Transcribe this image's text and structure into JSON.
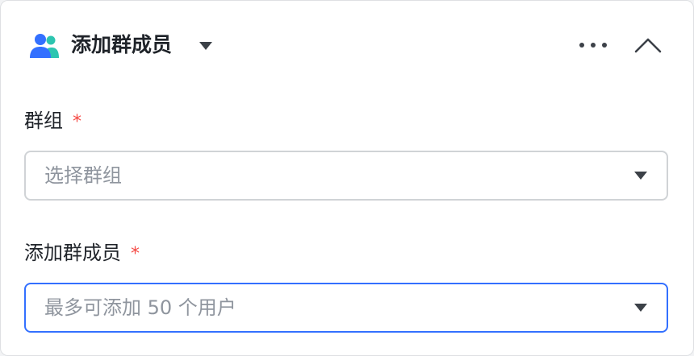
{
  "header": {
    "icon": "group-members-icon",
    "title": "添加群成员",
    "dropdown_icon": "caret-down-icon",
    "more_icon": "more-horizontal-icon",
    "collapse_icon": "chevron-up-icon"
  },
  "fields": [
    {
      "label": "群组",
      "required_mark": "*",
      "placeholder": "选择群组",
      "state": "default"
    },
    {
      "label": "添加群成员",
      "required_mark": "*",
      "placeholder": "最多可添加 50 个用户",
      "state": "focused"
    }
  ],
  "colors": {
    "required": "#f54a45",
    "focus_border": "#3370ff",
    "icon_blue": "#3370ff",
    "icon_teal": "#2dc5b0",
    "text_primary": "#1f2329",
    "placeholder": "#8f959e"
  }
}
